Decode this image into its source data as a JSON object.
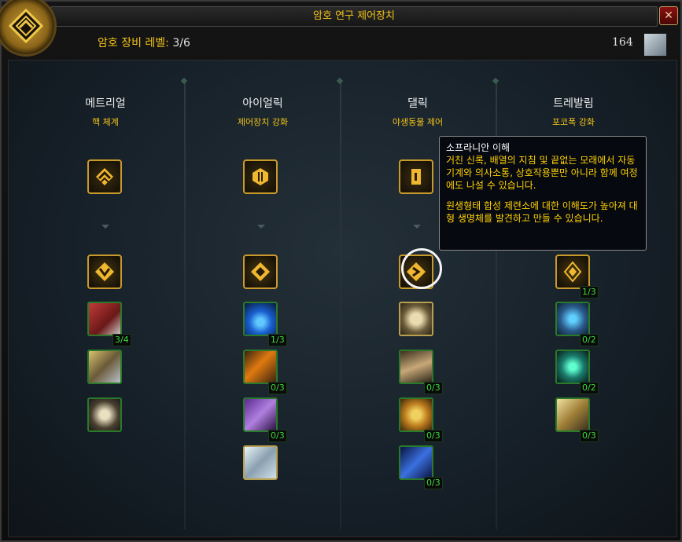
{
  "window": {
    "title": "암호 연구 제어장치",
    "close_glyph": "✕"
  },
  "header": {
    "level_label": "암호 장비 레벨: ",
    "level_value": "3/6",
    "currency_amount": "164"
  },
  "columns": [
    {
      "title": "메트리얼",
      "subtitle": "핵 체계"
    },
    {
      "title": "아이얼릭",
      "subtitle": "제어장치 강화"
    },
    {
      "title": "댈릭",
      "subtitle": "야생동물 제어"
    },
    {
      "title": "트레발림",
      "subtitle": "포코폭 강화"
    }
  ],
  "ranks": {
    "c1_r2": "3/4",
    "c2_r2": "1/3",
    "c2_r3": "0/3",
    "c2_r4": "0/3",
    "c3_r3": "0/3",
    "c3_r4": "0/3",
    "c3_r5": "0/3",
    "c4_r1": "1/3",
    "c4_r2": "0/2",
    "c4_r3": "0/2",
    "c4_r4": "0/3"
  },
  "tooltip": {
    "title": "소프라니안 이해",
    "line1": "거친 신록, 배열의 지침 및 끝없는 모래에서 자동기계와 의사소통, 상호작용뿐만 아니라 함께 여정에도 나설 수 있습니다.",
    "line2": "원생형태 합성 제련소에 대한 이해도가 높아져 대형 생명체를 발견하고 만들 수 있습니다."
  },
  "icons": {
    "emblem": "cypher-emblem-icon",
    "currency": "cypher-currency-icon"
  },
  "colors": {
    "gold_text": "#f2c318",
    "rank_green": "#3adb3a",
    "tooltip_yellow": "#ffd200"
  }
}
